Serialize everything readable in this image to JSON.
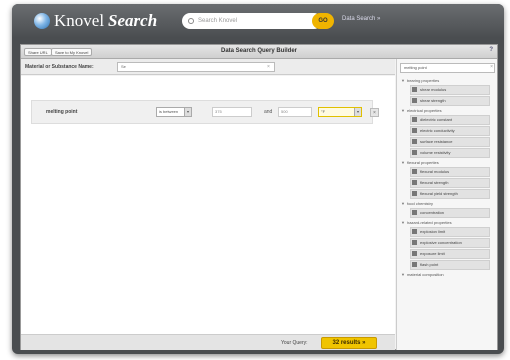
{
  "header": {
    "logo_text": "Knovel",
    "logo_search": "Search",
    "search_placeholder": "Search Knovel",
    "go_label": "GO",
    "data_search_link": "Data Search »"
  },
  "panel": {
    "share_url": "Share URL",
    "save_to_my_knovel": "Save to My Knovel",
    "title": "Data Search Query Builder",
    "help": "?"
  },
  "substance": {
    "label": "Material or Substance Name:",
    "value": "Se",
    "clear": "×"
  },
  "criteria": {
    "property": "melting point",
    "operator": "is between",
    "min": "375",
    "and": "and",
    "max": "500",
    "unit": "°F",
    "remove": "×",
    "arrow": "▾"
  },
  "footer": {
    "your_query": "Your Query:",
    "results": "32 results »"
  },
  "sidebar": {
    "filter_value": "melting point",
    "filter_clear": "×",
    "categories": [
      {
        "label": "bearing properties",
        "items": [
          "shear modulus",
          "shear strength"
        ]
      },
      {
        "label": "electrical properties",
        "items": [
          "dielectric constant",
          "electric conductivity",
          "surface resistance",
          "volume resistivity"
        ]
      },
      {
        "label": "flexural properties",
        "items": [
          "flexural modulus",
          "flexural strength",
          "flexural yield strength"
        ]
      },
      {
        "label": "food chemistry",
        "items": [
          "concentration"
        ]
      },
      {
        "label": "hazard-related properties",
        "items": [
          "explosion limit",
          "explosive concentration",
          "exposure limit",
          "flash point"
        ]
      },
      {
        "label": "material composition",
        "items": []
      }
    ]
  }
}
